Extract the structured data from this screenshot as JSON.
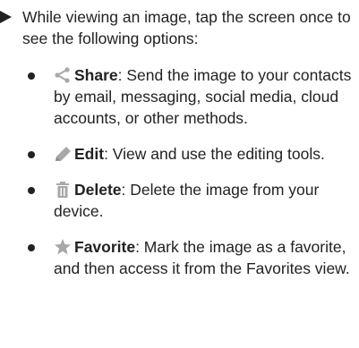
{
  "intro": "While viewing an image, tap the screen once to see the following options:",
  "options": [
    {
      "icon": "share-icon",
      "term": "Share",
      "description": ": Send the image to your contacts by email, messaging, social media, cloud accounts, or other methods."
    },
    {
      "icon": "pencil-icon",
      "term": "Edit",
      "description": ": View and use the editing tools."
    },
    {
      "icon": "trash-icon",
      "term": "Delete",
      "description": ": Delete the image from your device."
    },
    {
      "icon": "star-icon",
      "term": "Favorite",
      "description": ": Mark the image as a favorite, and then access it from the Favorites view."
    }
  ],
  "colors": {
    "text": "#222222",
    "icon_gray": "#a8a8a8"
  }
}
